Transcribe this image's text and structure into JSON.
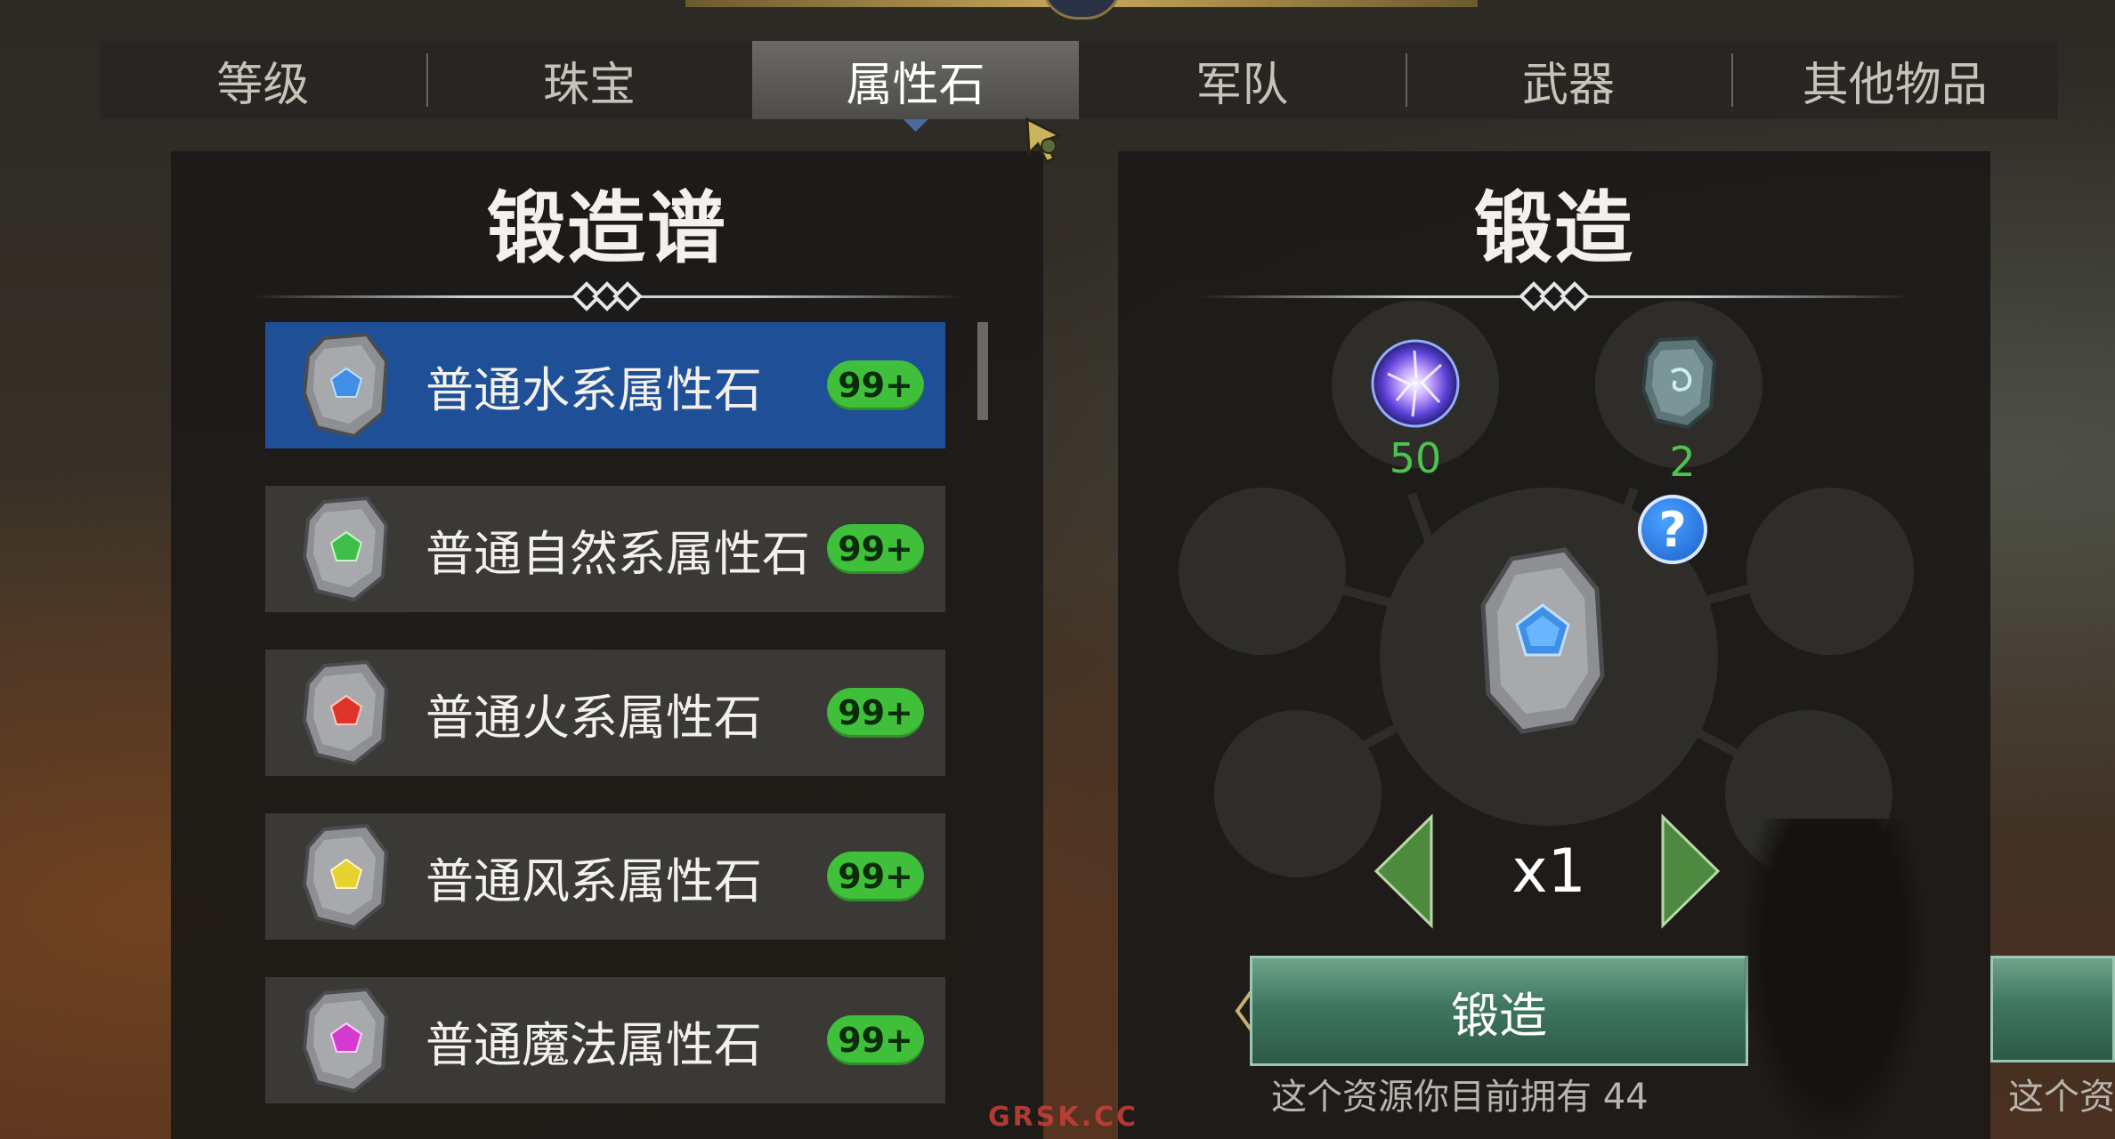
{
  "tabs": [
    {
      "label": "等级"
    },
    {
      "label": "珠宝"
    },
    {
      "label": "属性石",
      "active": true
    },
    {
      "label": "军队"
    },
    {
      "label": "武器"
    },
    {
      "label": "其他物品"
    }
  ],
  "recipe_panel": {
    "title": "锻造谱",
    "items": [
      {
        "name": "普通水系属性石",
        "count": "99+",
        "gem_color": "#3f8fe6",
        "selected": true
      },
      {
        "name": "普通自然系属性石",
        "count": "99+",
        "gem_color": "#3fbf4a",
        "selected": false
      },
      {
        "name": "普通火系属性石",
        "count": "99+",
        "gem_color": "#e0342a",
        "selected": false
      },
      {
        "name": "普通风系属性石",
        "count": "99+",
        "gem_color": "#e6d230",
        "selected": false
      },
      {
        "name": "普通魔法属性石",
        "count": "99+",
        "gem_color": "#d43ad0",
        "selected": false
      }
    ]
  },
  "forge_panel": {
    "title": "锻造",
    "ingredients": [
      {
        "icon": "energy-orb-icon",
        "count": "50"
      },
      {
        "icon": "raw-stone-icon",
        "count": "2"
      }
    ],
    "help_label": "?",
    "quantity": "x1",
    "forge_button_label": "锻造",
    "owned_text": "这个资源你目前拥有 44",
    "overflow_text": "这个资源"
  },
  "watermark": "GRSK.CC",
  "colors": {
    "accent_blue": "#1e4f97",
    "badge_green": "#3fbf3a",
    "count_green": "#4ec24e",
    "forge_green": "#3f7660"
  }
}
